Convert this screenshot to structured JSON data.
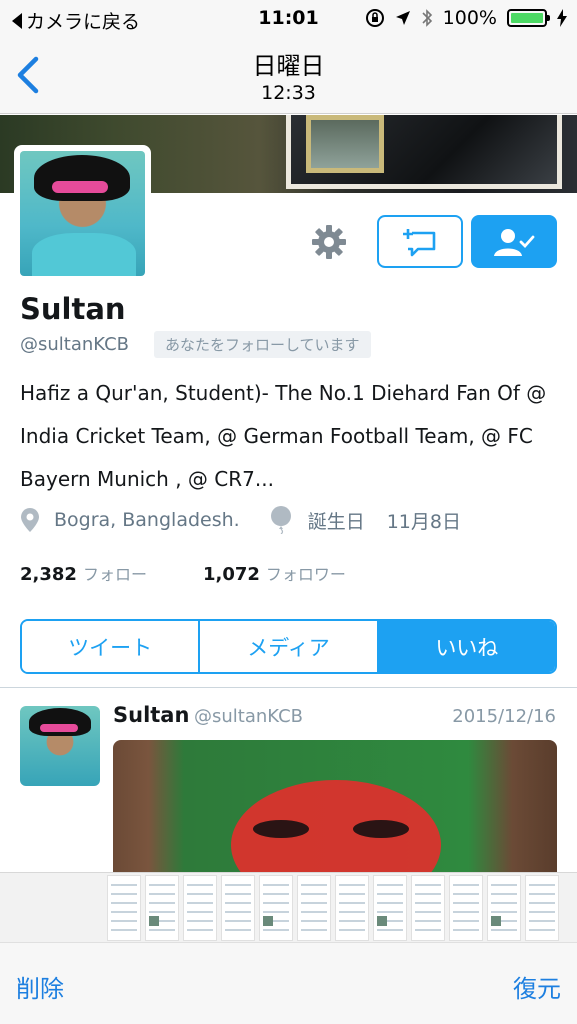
{
  "status_bar": {
    "back_app_label": "カメラに戻る",
    "time": "11:01",
    "battery": "100%",
    "battery_level": 1.0
  },
  "nav": {
    "title": "日曜日",
    "subtitle": "12:33"
  },
  "profile": {
    "name": "Sultan",
    "handle": "@sultanKCB",
    "follows_you": "あなたをフォローしています",
    "bio": "Hafiz a Qur'an, Student)- The No.1 Diehard Fan Of @ India Cricket Team, @ German Football Team, @ FC Bayern Munich , @ CR7...",
    "location": "Bogra, Bangladesh.",
    "birthday_label": "誕生日",
    "birthday_value": "11月8日",
    "following_count": "2,382",
    "following_label": "フォロー",
    "followers_count": "1,072",
    "followers_label": "フォロワー"
  },
  "tabs": [
    {
      "label": "ツイート",
      "active": false
    },
    {
      "label": "メディア",
      "active": false
    },
    {
      "label": "いいね",
      "active": true
    }
  ],
  "tweet": {
    "name": "Sultan",
    "handle": "@sultanKCB",
    "date": "2015/12/16"
  },
  "toolbar": {
    "delete_label": "削除",
    "restore_label": "復元"
  },
  "colors": {
    "accent": "#1da1f2",
    "ios_blue": "#1d7fe0",
    "battery_green": "#4cd964"
  },
  "icons": {
    "back": "chevron-left-icon",
    "settings": "gear-icon",
    "message": "direct-message-icon",
    "following": "person-check-icon",
    "location": "location-pin-icon",
    "birthday": "balloon-icon"
  }
}
